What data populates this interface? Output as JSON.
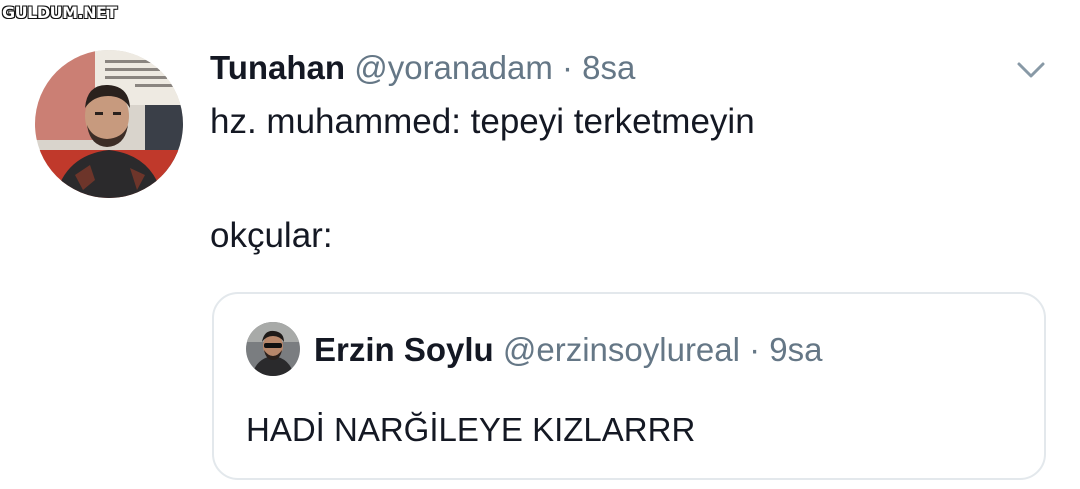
{
  "watermark": "GULDUM.NET",
  "tweet": {
    "display_name": "Tunahan",
    "handle": "@yoranadam",
    "separator": " · ",
    "time": "8sa",
    "text_line1": "hz. muhammed: tepeyi terketmeyin",
    "text_line2": "okçular:",
    "menu_icon": "chevron-down-icon"
  },
  "quoted_tweet": {
    "display_name": "Erzin Soylu",
    "handle": "@erzinsoylureal",
    "separator": " · ",
    "time": "9sa",
    "text": "HADİ NARĞİLEYE KIZLARRR"
  },
  "colors": {
    "text_primary": "#141823",
    "text_secondary": "#657786",
    "border": "#e3e8ec",
    "background": "#ffffff"
  }
}
